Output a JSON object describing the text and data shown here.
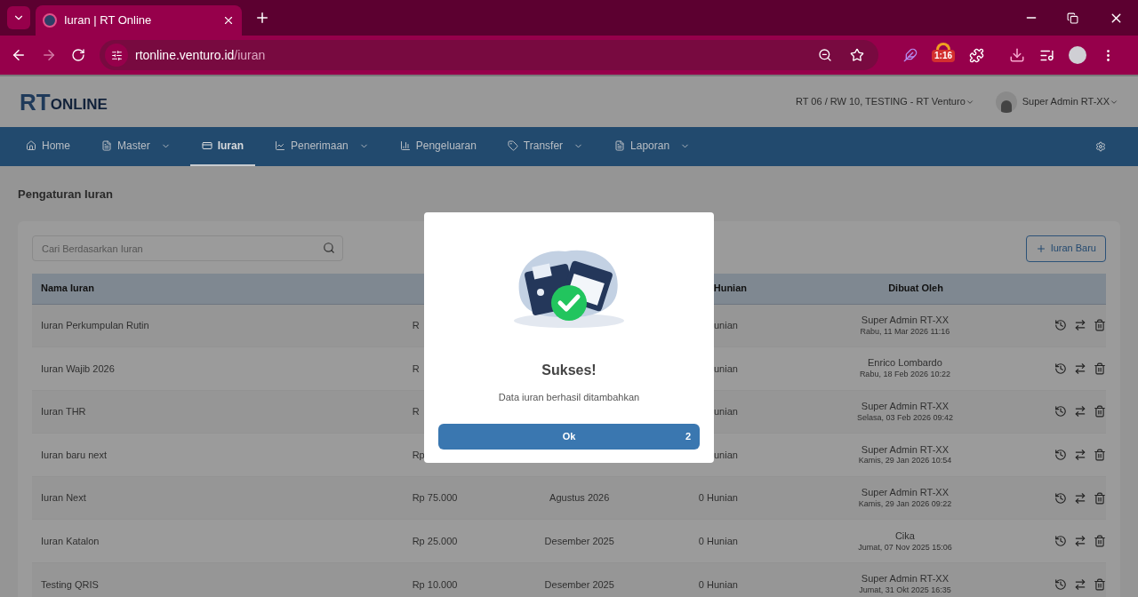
{
  "browser": {
    "tab_title": "Iuran | RT Online",
    "url_host": "rtonline.venturo.id",
    "url_path": "/iuran",
    "extension_badge": "1:16"
  },
  "header": {
    "logo_rt": "RT",
    "logo_online": "ONLINE",
    "location": "RT 06 / RW 10, TESTING - RT Venturo",
    "user": "Super Admin RT-XX"
  },
  "nav": [
    {
      "label": "Home",
      "dropdown": false,
      "selected": false
    },
    {
      "label": "Master",
      "dropdown": true,
      "selected": false
    },
    {
      "label": "Iuran",
      "dropdown": false,
      "selected": true
    },
    {
      "label": "Penerimaan",
      "dropdown": true,
      "selected": false
    },
    {
      "label": "Pengeluaran",
      "dropdown": false,
      "selected": false
    },
    {
      "label": "Transfer",
      "dropdown": true,
      "selected": false
    },
    {
      "label": "Laporan",
      "dropdown": true,
      "selected": false
    }
  ],
  "page_title": "Pengaturan Iuran",
  "search": {
    "placeholder": "Cari Berdasarkan Iuran"
  },
  "new_button": "Iuran Baru",
  "table": {
    "columns": [
      "Nama Iuran",
      "",
      "",
      "Hunian",
      "Dibuat Oleh"
    ],
    "rows": [
      {
        "name": "Iuran Perkumpulan Rutin",
        "amount": "R",
        "period": "",
        "residents": "unian",
        "by": "Super Admin RT-XX",
        "date": "Rabu, 11 Mar 2026 11:16"
      },
      {
        "name": "Iuran Wajib 2026",
        "amount": "R",
        "period": "",
        "residents": "unian",
        "by": "Enrico Lombardo",
        "date": "Rabu, 18 Feb 2026 10:22"
      },
      {
        "name": "Iuran THR",
        "amount": "R",
        "period": "",
        "residents": "unian",
        "by": "Super Admin RT-XX",
        "date": "Selasa, 03 Feb 2026 09:42"
      },
      {
        "name": "Iuran baru next",
        "amount": "Rp",
        "period": "",
        "residents": "unian",
        "by": "Super Admin RT-XX",
        "date": "Kamis, 29 Jan 2026 10:54"
      },
      {
        "name": "Iuran Next",
        "amount": "Rp 75.000",
        "period": "Agustus 2026",
        "residents": "0 Hunian",
        "by": "Super Admin RT-XX",
        "date": "Kamis, 29 Jan 2026 09:22"
      },
      {
        "name": "Iuran Katalon",
        "amount": "Rp 25.000",
        "period": "Desember 2025",
        "residents": "0 Hunian",
        "by": "Cika",
        "date": "Jumat, 07 Nov 2025 15:06"
      },
      {
        "name": "Testing QRIS",
        "amount": "Rp 10.000",
        "period": "Desember 2025",
        "residents": "0 Hunian",
        "by": "Super Admin RT-XX",
        "date": "Jumat, 31 Okt 2025 16:35"
      }
    ]
  },
  "modal": {
    "title": "Sukses!",
    "message": "Data iuran berhasil ditambahkan",
    "button": "Ok",
    "button_count": "2"
  }
}
